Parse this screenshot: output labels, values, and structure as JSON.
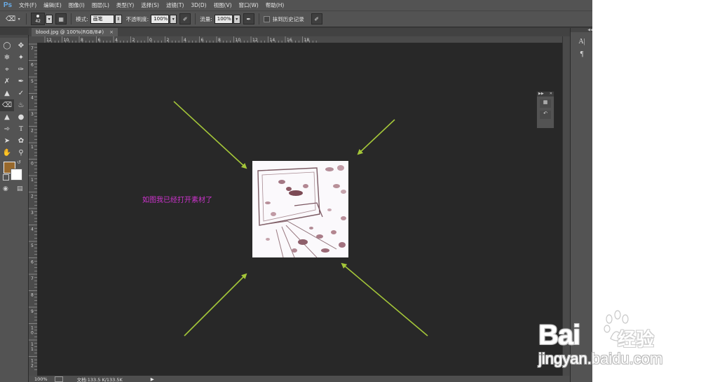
{
  "app": {
    "logo": "Ps"
  },
  "menu": [
    "文件(F)",
    "编辑(E)",
    "图像(I)",
    "图层(L)",
    "类型(Y)",
    "选择(S)",
    "滤镜(T)",
    "3D(D)",
    "视图(V)",
    "窗口(W)",
    "帮助(H)"
  ],
  "options": {
    "brush_size": "42",
    "mode_label": "模式:",
    "mode_value": "画笔",
    "opacity_label": "不透明度:",
    "opacity_value": "100%",
    "flow_label": "流量:",
    "flow_value": "100%",
    "erase_history_label": "抹到历史记录"
  },
  "document": {
    "tab_title": "blood.jpg @ 100%(RGB/8#)",
    "tab_close": "×",
    "zoom": "100%",
    "file_info": "文档:133.5 K/133.5K"
  },
  "rulers": {
    "top": [
      "12",
      "10",
      "8",
      "6",
      "4",
      "2",
      "0",
      "2",
      "4",
      "6",
      "8",
      "10",
      "12",
      "14",
      "16",
      "18"
    ],
    "left": [
      "7",
      "6",
      "5",
      "4",
      "3",
      "2",
      "1",
      "0",
      "1",
      "2",
      "3",
      "4",
      "5",
      "6",
      "7",
      "8",
      "9",
      "1 0",
      "1 1",
      "1 2"
    ]
  },
  "canvas": {
    "caption": "如图我已经打开素材了",
    "caption_color": "#cc33cc",
    "arrow_color": "#a4c639"
  },
  "colors": {
    "foreground": "#98692d",
    "background": "#ffffff"
  },
  "watermark": {
    "brand": "Bai",
    "brand_suffix": "经验",
    "site": "jingyan.baidu.com"
  }
}
